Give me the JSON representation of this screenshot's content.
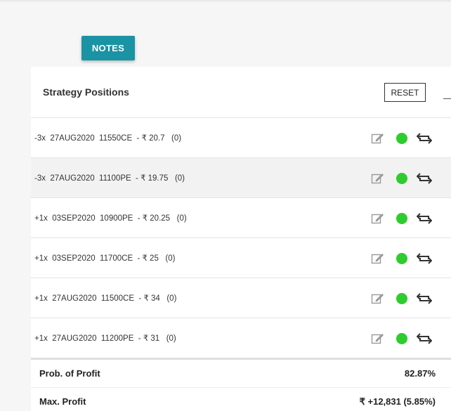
{
  "toolbar": {
    "notes_label": "NOTES"
  },
  "strategy": {
    "title": "Strategy Positions",
    "reset_label": "RESET",
    "positions": [
      {
        "text": "-3x  27AUG2020  11550CE  - ₹ 20.7   (0)"
      },
      {
        "text": "-3x  27AUG2020  11100PE  - ₹ 19.75   (0)"
      },
      {
        "text": "+1x  03SEP2020  10900PE  - ₹ 20.25   (0)"
      },
      {
        "text": "+1x  03SEP2020  11700CE  - ₹ 25   (0)"
      },
      {
        "text": "+1x  27AUG2020  11500CE  - ₹ 34   (0)"
      },
      {
        "text": "+1x  27AUG2020  11200PE  - ₹ 31   (0)"
      }
    ],
    "status_color": "#2ecc2e"
  },
  "summary": {
    "prob_label": "Prob. of Profit",
    "prob_value": "82.87%",
    "max_label": "Max. Profit",
    "max_value": "₹ +12,831 (5.85%)"
  },
  "icons": [
    "edit-icon",
    "status-dot",
    "swap-icon"
  ]
}
